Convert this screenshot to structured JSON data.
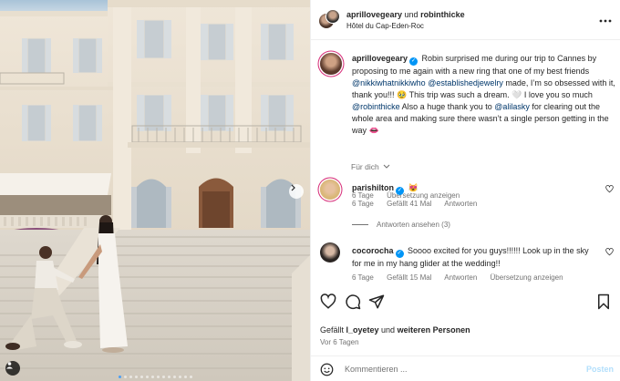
{
  "header": {
    "user1": "aprillovegeary",
    "connector": "und",
    "user2": "robinthicke",
    "location": "Hôtel du Cap-Eden-Roc"
  },
  "caption": {
    "username": "aprillovegeary",
    "text1": " Robin surprised me during our trip to Cannes by proposing to me again with a new ring that one of my best friends ",
    "mention1": "@nikkiwhatnikkiwho",
    "text2": " ",
    "mention2": "@establishedjewelry",
    "text3": " made, I’m so obsessed with it, thank you!!! 🥹 This trip was such a dream. 🤍 I love you so much ",
    "mention3": "@robinthicke",
    "text4": " Also a huge thank you to ",
    "mention4": "@alilasky",
    "text5": " for clearing out the whole area and making sure there wasn’t a single person getting in the way 👄",
    "time": "6 Tage",
    "translate": "Übersetzung anzeigen"
  },
  "for_you": "Für dich",
  "comments": [
    {
      "username": "parishilton",
      "text": " 😻",
      "time": "6 Tage",
      "likes": "Gefällt 41 Mal",
      "reply": "Antworten",
      "view_replies": "Antworten ansehen (3)"
    },
    {
      "username": "cocorocha",
      "text": " Soooo excited for you guys!!!!!! Look up in the sky for me in my hang glider at the wedding!!",
      "time": "6 Tage",
      "likes": "Gefällt 15 Mal",
      "reply": "Antworten",
      "translate": "Übersetzung anzeigen"
    }
  ],
  "likes": {
    "prefix": "Gefällt ",
    "user": "l_oyetey",
    "middle": " und ",
    "others": "weiteren Personen"
  },
  "date": "Vor 6 Tagen",
  "composer": {
    "placeholder": "Kommentieren ...",
    "post_label": "Posten"
  },
  "carousel": {
    "slides": 14,
    "active": 1
  },
  "icons": [
    "heart-icon",
    "comment-icon",
    "share-icon",
    "bookmark-icon",
    "emoji-icon",
    "chevron-right-icon",
    "user-tag-icon",
    "more-icon",
    "verified-icon"
  ],
  "colors": {
    "link": "#00376b",
    "verified": "#0095f6",
    "meta": "#737373",
    "post_disabled": "#b2dffc",
    "carousel_active": "#4a9ff5"
  }
}
